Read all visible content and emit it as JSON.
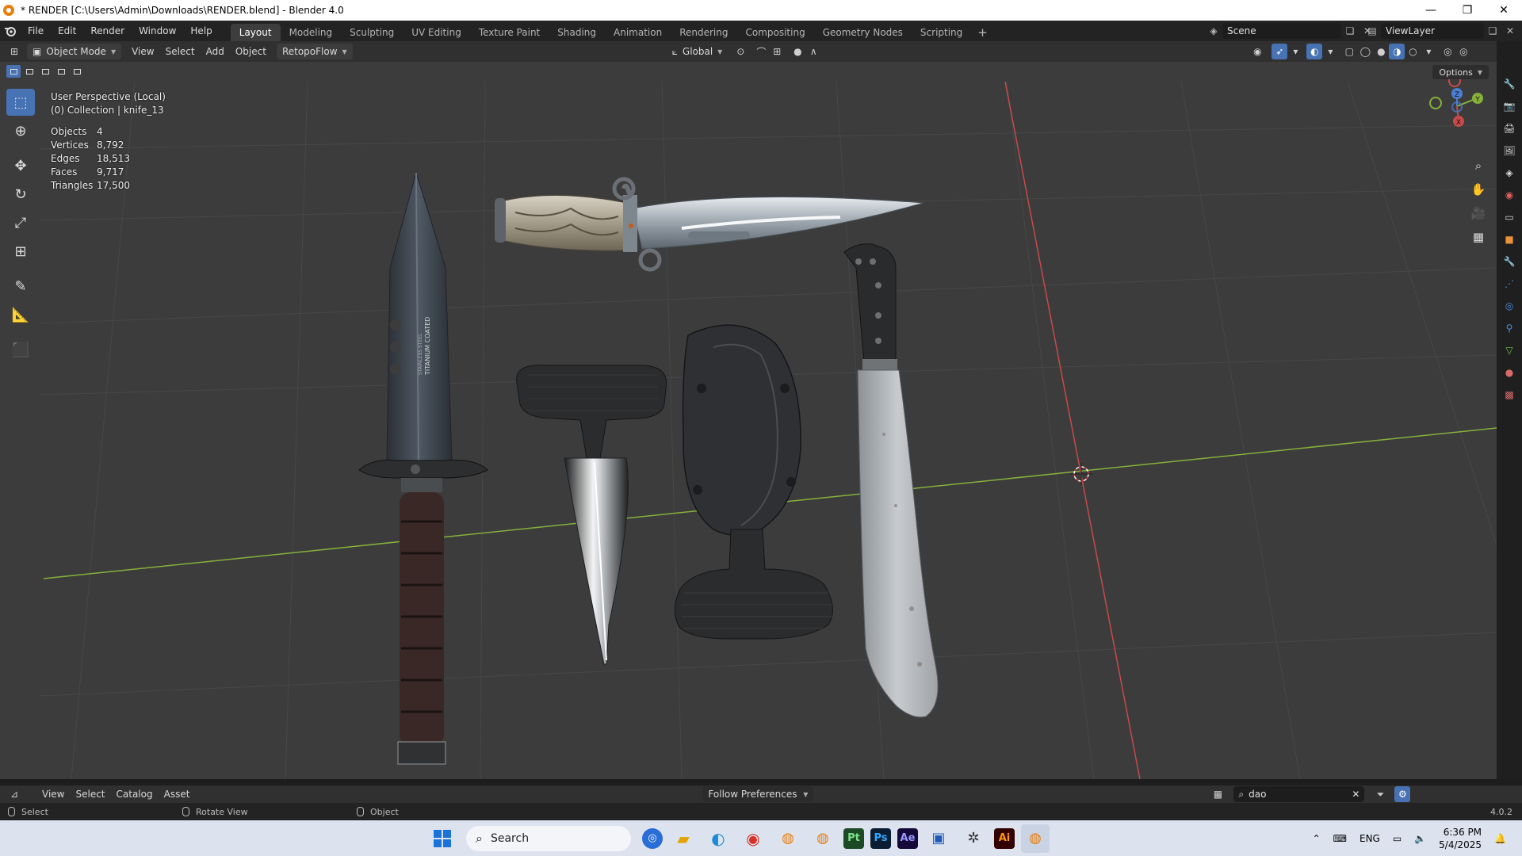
{
  "window": {
    "title": "* RENDER [C:\\Users\\Admin\\Downloads\\RENDER.blend] - Blender 4.0",
    "minimize": "—",
    "maximize": "❐",
    "close": "✕"
  },
  "menu": [
    "File",
    "Edit",
    "Render",
    "Window",
    "Help"
  ],
  "workspaces": [
    "Layout",
    "Modeling",
    "Sculpting",
    "UV Editing",
    "Texture Paint",
    "Shading",
    "Animation",
    "Rendering",
    "Compositing",
    "Geometry Nodes",
    "Scripting"
  ],
  "workspace_add": "+",
  "scene": {
    "name": "Scene",
    "view_layer": "ViewLayer"
  },
  "view_header": {
    "mode": "Object Mode",
    "menus": [
      "View",
      "Select",
      "Add",
      "Object"
    ],
    "addon": "RetopoFlow",
    "orientation": "Global",
    "options": "Options"
  },
  "overlay": {
    "perspective": "User Perspective (Local)",
    "collection": "(0) Collection | knife_13",
    "stats": [
      {
        "label": "Objects",
        "value": "4"
      },
      {
        "label": "Vertices",
        "value": "8,792"
      },
      {
        "label": "Edges",
        "value": "18,513"
      },
      {
        "label": "Faces",
        "value": "9,717"
      },
      {
        "label": "Triangles",
        "value": "17,500"
      }
    ]
  },
  "gizmo": {
    "z": "Z",
    "y": "Y",
    "x": "X"
  },
  "blade_text": {
    "line1": "TITANIUM COATED",
    "line2": "STAINLESS STEEL"
  },
  "asset_bar": {
    "menus": [
      "View",
      "Select",
      "Catalog",
      "Asset"
    ],
    "import_method": "Follow Preferences",
    "search_value": "dao"
  },
  "status_bar": {
    "items": [
      "Select",
      "Rotate View",
      "Object"
    ],
    "version": "4.0.2"
  },
  "taskbar": {
    "search_placeholder": "Search",
    "apps": [
      "Pt",
      "Ps",
      "Ae",
      "Ai"
    ],
    "language": "ENG",
    "time": "6:36 PM",
    "date": "5/4/2025"
  },
  "colors": {
    "accent": "#4772b3",
    "x_axis": "#c84a4a",
    "y_axis": "#86b13a",
    "viewport_bg": "#3c3c3c"
  }
}
